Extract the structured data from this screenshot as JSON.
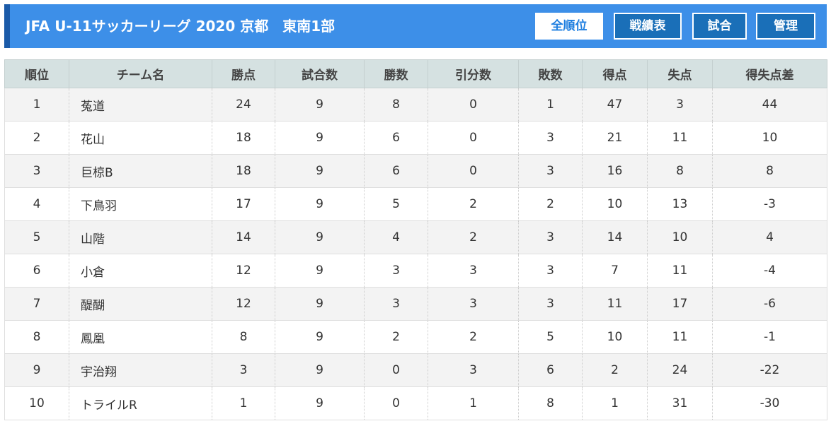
{
  "header": {
    "title": "JFA U-11サッカーリーグ 2020 京都　東南1部",
    "nav": [
      {
        "label": "全順位",
        "active": true
      },
      {
        "label": "戦績表",
        "active": false
      },
      {
        "label": "試合",
        "active": false
      },
      {
        "label": "管理",
        "active": false
      }
    ]
  },
  "table": {
    "columns": [
      "順位",
      "チーム名",
      "勝点",
      "試合数",
      "勝数",
      "引分数",
      "敗数",
      "得点",
      "失点",
      "得失点差"
    ],
    "rows": [
      [
        "1",
        "菟道",
        "24",
        "9",
        "8",
        "0",
        "1",
        "47",
        "3",
        "44"
      ],
      [
        "2",
        "花山",
        "18",
        "9",
        "6",
        "0",
        "3",
        "21",
        "11",
        "10"
      ],
      [
        "3",
        "巨椋B",
        "18",
        "9",
        "6",
        "0",
        "3",
        "16",
        "8",
        "8"
      ],
      [
        "4",
        "下鳥羽",
        "17",
        "9",
        "5",
        "2",
        "2",
        "10",
        "13",
        "-3"
      ],
      [
        "5",
        "山階",
        "14",
        "9",
        "4",
        "2",
        "3",
        "14",
        "10",
        "4"
      ],
      [
        "6",
        "小倉",
        "12",
        "9",
        "3",
        "3",
        "3",
        "7",
        "11",
        "-4"
      ],
      [
        "7",
        "醍醐",
        "12",
        "9",
        "3",
        "3",
        "3",
        "11",
        "17",
        "-6"
      ],
      [
        "8",
        "鳳凰",
        "8",
        "9",
        "2",
        "2",
        "5",
        "10",
        "11",
        "-1"
      ],
      [
        "9",
        "宇治翔",
        "3",
        "9",
        "0",
        "3",
        "6",
        "2",
        "24",
        "-22"
      ],
      [
        "10",
        "トライルR",
        "1",
        "9",
        "0",
        "1",
        "8",
        "1",
        "31",
        "-30"
      ]
    ]
  }
}
